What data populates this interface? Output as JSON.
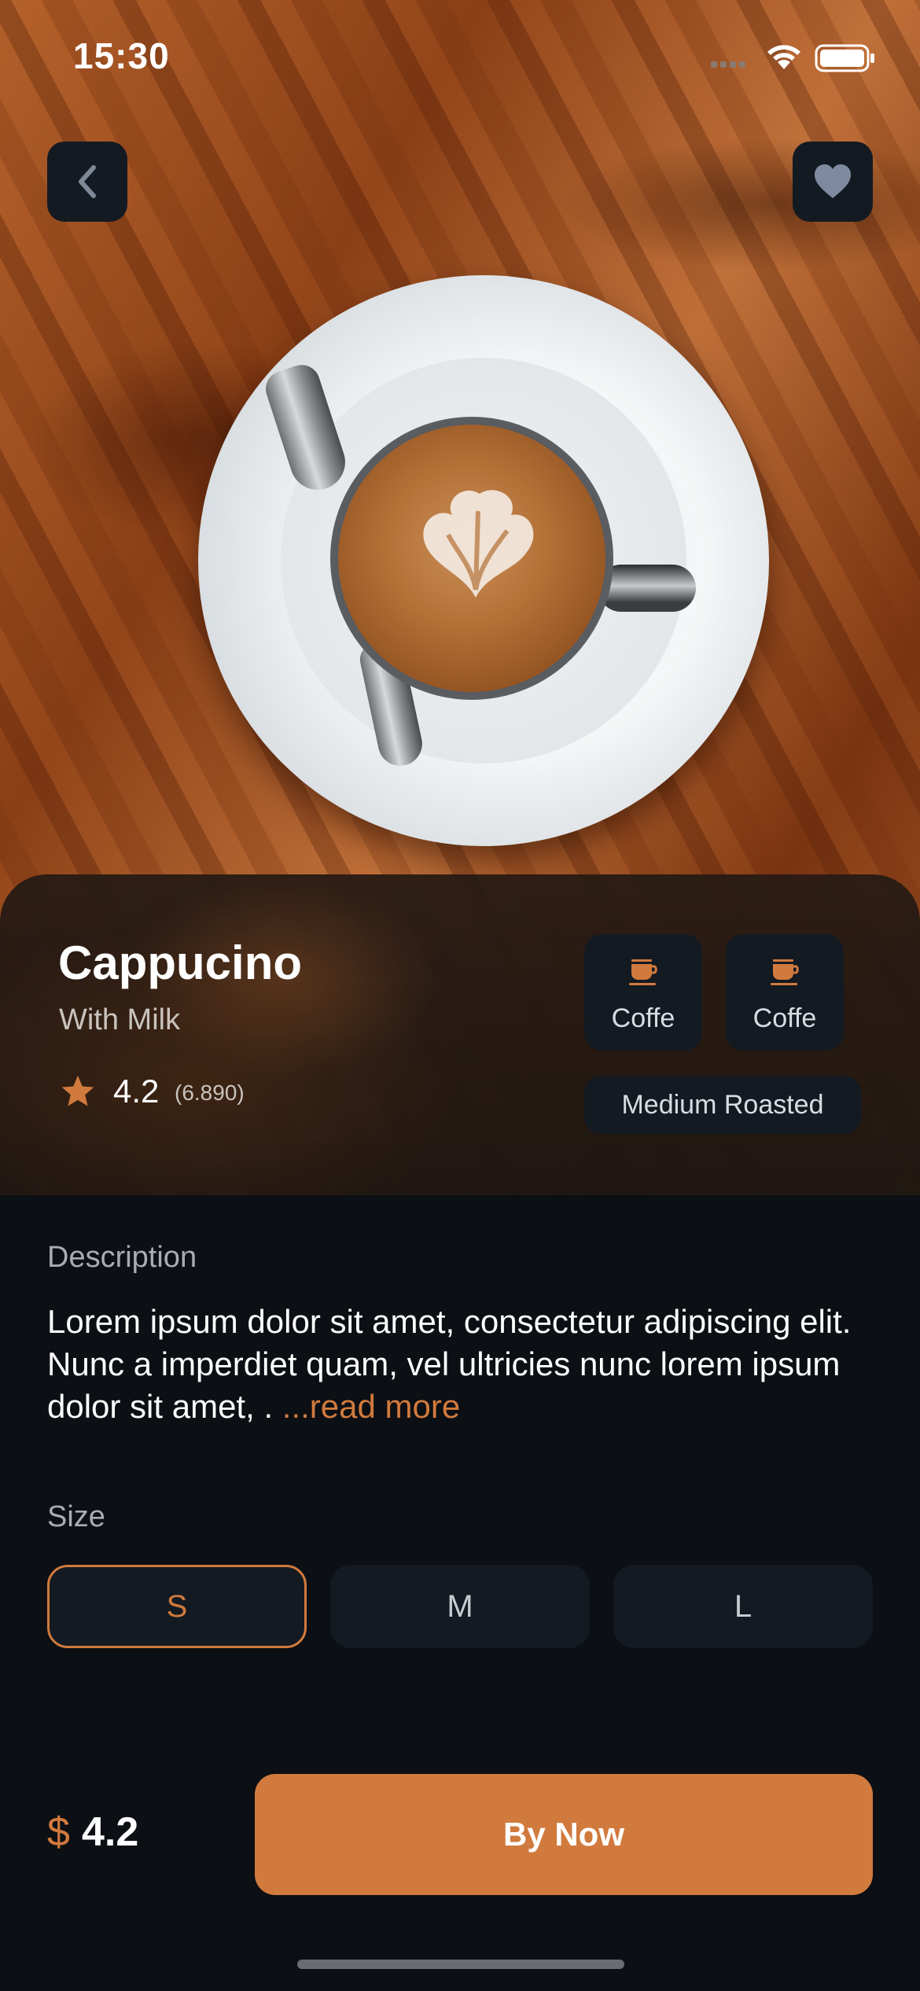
{
  "status_bar": {
    "time": "15:30",
    "icons": [
      "signal-icon",
      "wifi-icon",
      "battery-icon"
    ]
  },
  "header": {
    "back_icon": "chevron-left-icon",
    "favorite_icon": "heart-icon"
  },
  "product": {
    "name": "Cappucino",
    "subtitle": "With Milk",
    "rating": "4.2",
    "rating_count": "(6.890)",
    "tags": [
      {
        "icon": "coffee-cup-icon",
        "label": "Coffe"
      },
      {
        "icon": "coffee-cup-icon",
        "label": "Coffe"
      }
    ],
    "roast": "Medium Roasted"
  },
  "description": {
    "heading": "Description",
    "text": "Lorem ipsum dolor sit amet, consectetur adipiscing elit. Nunc a imperdiet quam, vel ultricies nunc lorem ipsum dolor sit amet, . ",
    "read_more": "...read more"
  },
  "size": {
    "heading": "Size",
    "options": [
      "S",
      "M",
      "L"
    ],
    "selected": "S"
  },
  "checkout": {
    "currency": "$",
    "price": "4.2",
    "buy_label": "By Now"
  },
  "colors": {
    "accent": "#d17a3d",
    "background": "#0c0f14",
    "surface": "#141a22"
  }
}
